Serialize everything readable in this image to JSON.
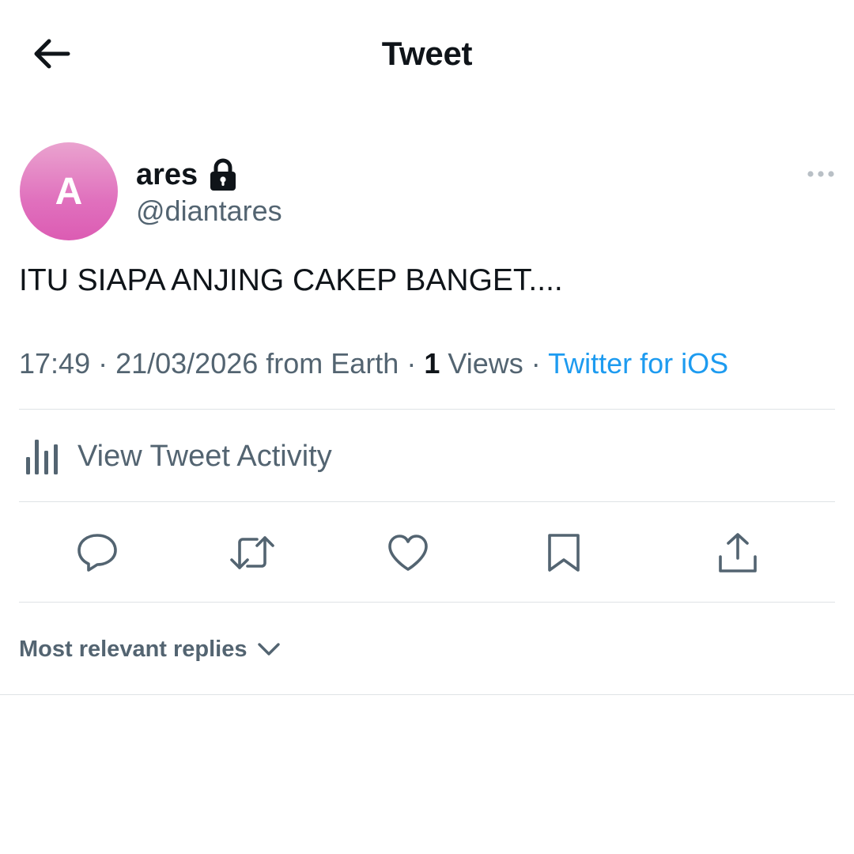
{
  "header": {
    "title": "Tweet",
    "back_icon": "arrow-left-icon"
  },
  "tweet": {
    "author": {
      "avatar_letter": "A",
      "display_name": "ares",
      "handle": "@diantares",
      "protected_icon": "lock-icon"
    },
    "text": "ITU SIAPA ANJING CAKEP BANGET....",
    "meta": {
      "time": "17:49",
      "sep1": " · ",
      "date": "21/03/2026",
      "location": " from Earth",
      "sep2": " · ",
      "views_count": "1",
      "views_label": " Views",
      "sep3": " · ",
      "source": "Twitter for iOS"
    }
  },
  "activity": {
    "label": "View Tweet Activity",
    "icon": "bar-chart-icon"
  },
  "actions": [
    {
      "name": "reply",
      "icon": "reply-icon"
    },
    {
      "name": "retweet",
      "icon": "retweet-icon"
    },
    {
      "name": "like",
      "icon": "heart-icon"
    },
    {
      "name": "bookmark",
      "icon": "bookmark-icon"
    },
    {
      "name": "share",
      "icon": "share-icon"
    }
  ],
  "replies": {
    "sort_label": "Most relevant replies",
    "sort_icon": "chevron-down-icon"
  },
  "colors": {
    "text_primary": "#0f1419",
    "text_secondary": "#536471",
    "link": "#1d9bf0",
    "divider": "#dfe3e6",
    "avatar_gradient_top": "#eaa3cf",
    "avatar_gradient_bottom": "#dc5cb3"
  }
}
